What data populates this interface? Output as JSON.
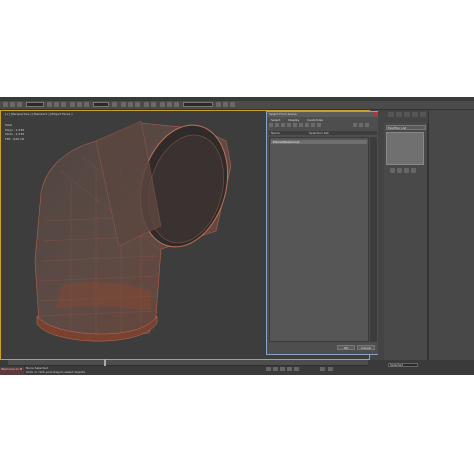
{
  "viewport": {
    "label": "[+] [Perspective ] [Standard ] [Edged Faces ]",
    "stats": [
      "Total",
      "Polys : 1,536",
      "Verts : 1,536",
      "FPS : 626.18"
    ]
  },
  "command_panel": {
    "material_title": "Modifier List"
  },
  "dialog": {
    "title": "Select From Scene",
    "menu": [
      "Select",
      "Display",
      "Customize"
    ],
    "header": {
      "name": "Name",
      "frozen": "Selection Set"
    },
    "item": "Elbow/Pipe/Group",
    "ok_label": "OK",
    "cancel_label": "Cancel"
  },
  "timeline": {
    "status": "None Selected",
    "prompt": "Click or click-and-drag to select objects",
    "frame": "Selected",
    "welcome": "Welcome to M"
  },
  "colors": {
    "viewport_bg": "#3d3d3d",
    "active_border": "#c9a227",
    "pipe": "#5a4742",
    "wire": "#b4614a"
  }
}
